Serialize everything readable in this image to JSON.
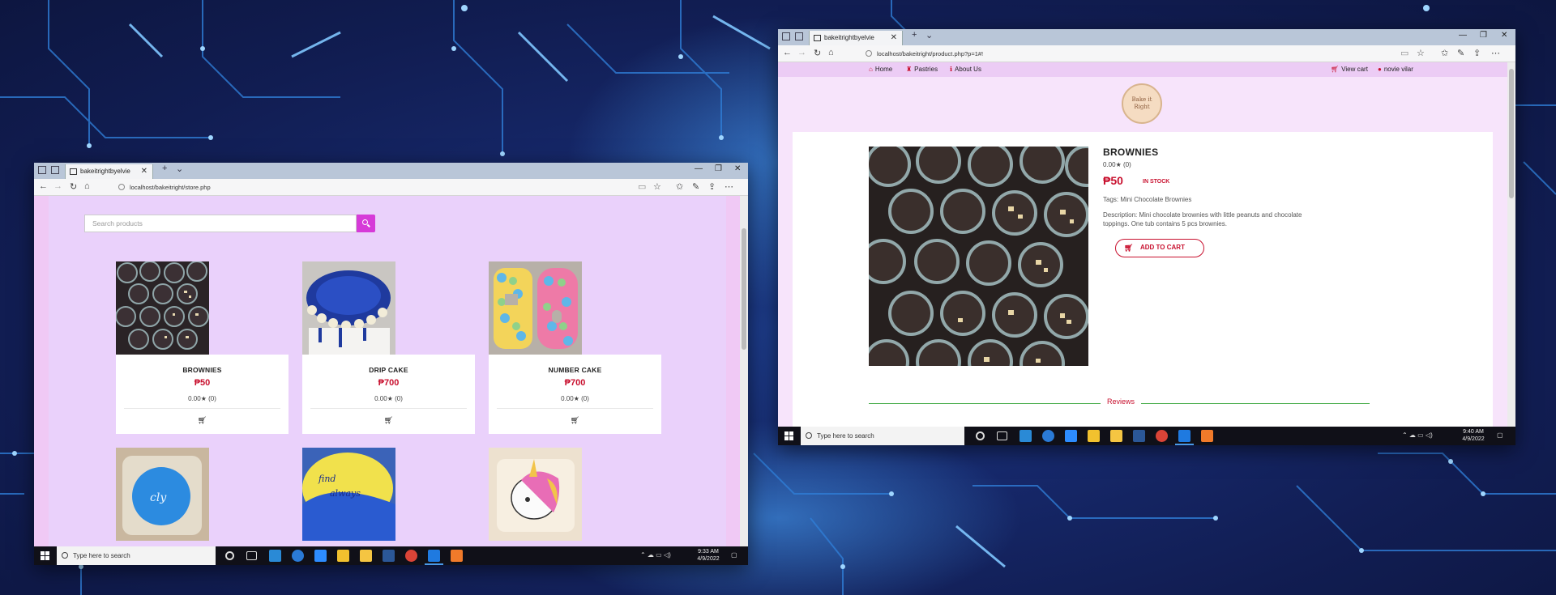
{
  "store_window": {
    "tab_title": "bakeitrightbyelvie",
    "url": "localhost/bakeitright/store.php",
    "search_placeholder": "Search products",
    "products": [
      {
        "name": "BROWNIES",
        "price": "₱50",
        "rating": "0.00★ (0)"
      },
      {
        "name": "DRIP CAKE",
        "price": "₱700",
        "rating": "0.00★ (0)"
      },
      {
        "name": "NUMBER CAKE",
        "price": "₱700",
        "rating": "0.00★ (0)"
      }
    ],
    "taskbar": {
      "search_text": "Type here to search",
      "time": "9:33 AM",
      "date": "4/9/2022"
    }
  },
  "product_window": {
    "tab_title": "bakeitrightbyelvie",
    "url": "localhost/bakeitright/product.php?p=1#!",
    "nav": {
      "home": "Home",
      "pastries": "Pastries",
      "about": "About Us",
      "view_cart": "View cart",
      "user": "novie vilar"
    },
    "logo_text": "Bake it Right",
    "product": {
      "name": "BROWNIES",
      "rating": "0.00★ (0)",
      "price": "₱50",
      "stock": "IN STOCK",
      "tags": "Tags: Mini Chocolate Brownies",
      "description": "Description: Mini chocolate brownies with little peanuts and chocolate toppings. One tub contains 5 pcs brownies.",
      "add_to_cart": "ADD TO CART"
    },
    "reviews_label": "Reviews",
    "taskbar": {
      "search_text": "Type here to search",
      "time": "9:40 AM",
      "date": "4/9/2022"
    }
  },
  "colors": {
    "accent": "#c8102e",
    "search_button": "#d63ad8",
    "page_bg": "#ead1fb",
    "reviews_line": "#4caf50"
  }
}
